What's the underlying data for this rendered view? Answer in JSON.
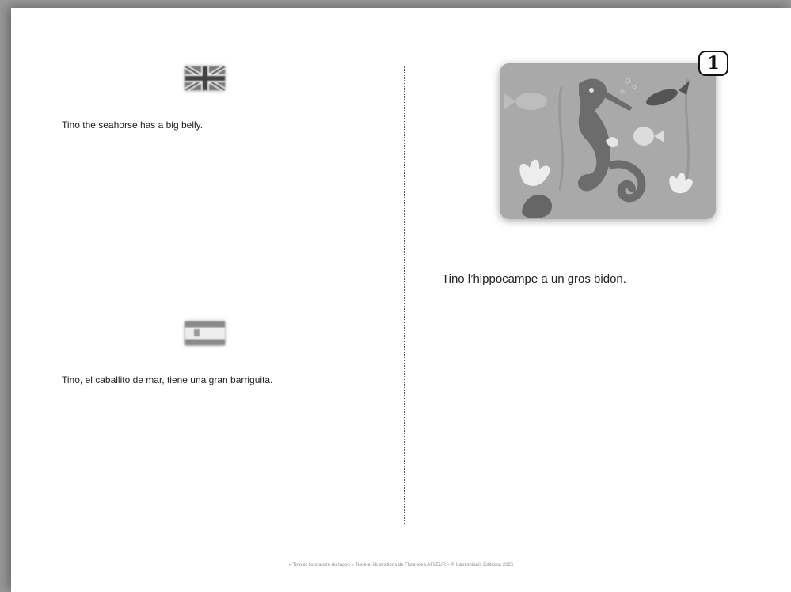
{
  "card": {
    "page_number": "1",
    "english": {
      "flag": "uk-flag-icon",
      "text": "Tino the seahorse has a big belly."
    },
    "spanish": {
      "flag": "spain-flag-icon",
      "text": "Tino, el caballito de mar, tiene una gran barriguita."
    },
    "french": {
      "text": "Tino l’hippocampe a un gros bidon."
    },
    "illustration": "seahorse-illustration",
    "footer": "« Tino et l’orchestre du lagon » Texte et illustrations de Florence LAFLEUR – © Kamishibaïs Éditions, 2026"
  }
}
